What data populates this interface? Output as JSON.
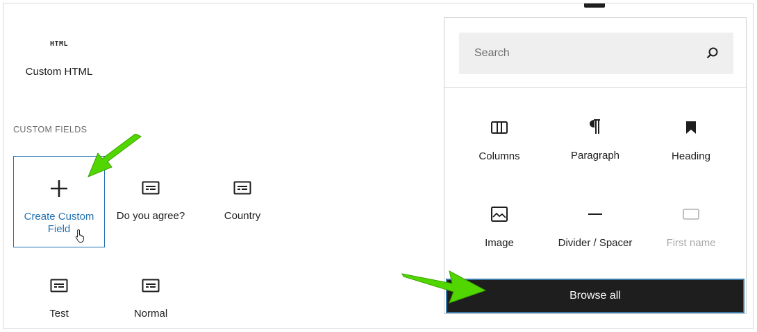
{
  "left": {
    "top_block": {
      "icon": "html-icon",
      "icon_text": "HTML",
      "label": "Custom HTML"
    },
    "section_title": "CUSTOM FIELDS",
    "blocks": [
      {
        "label": "Create Custom Field",
        "icon": "plus-icon",
        "selected": true
      },
      {
        "label": "Do you agree?",
        "icon": "field-icon"
      },
      {
        "label": "Country",
        "icon": "field-icon"
      },
      {
        "label": "Test",
        "icon": "field-icon"
      },
      {
        "label": "Normal",
        "icon": "field-icon"
      }
    ]
  },
  "panel": {
    "search": {
      "placeholder": "Search",
      "value": "",
      "icon": "search-icon"
    },
    "blocks": [
      {
        "label": "Columns",
        "icon": "columns-icon"
      },
      {
        "label": "Paragraph",
        "icon": "paragraph-icon"
      },
      {
        "label": "Heading",
        "icon": "bookmark-icon"
      },
      {
        "label": "Image",
        "icon": "image-icon"
      },
      {
        "label": "Divider / Spacer",
        "icon": "divider-icon"
      },
      {
        "label": "First name",
        "icon": "input-icon",
        "disabled": true
      }
    ],
    "browse_all": "Browse all"
  },
  "colors": {
    "accent": "#2271b1",
    "arrow": "#52d600",
    "button_bg": "#1e1e1e"
  }
}
